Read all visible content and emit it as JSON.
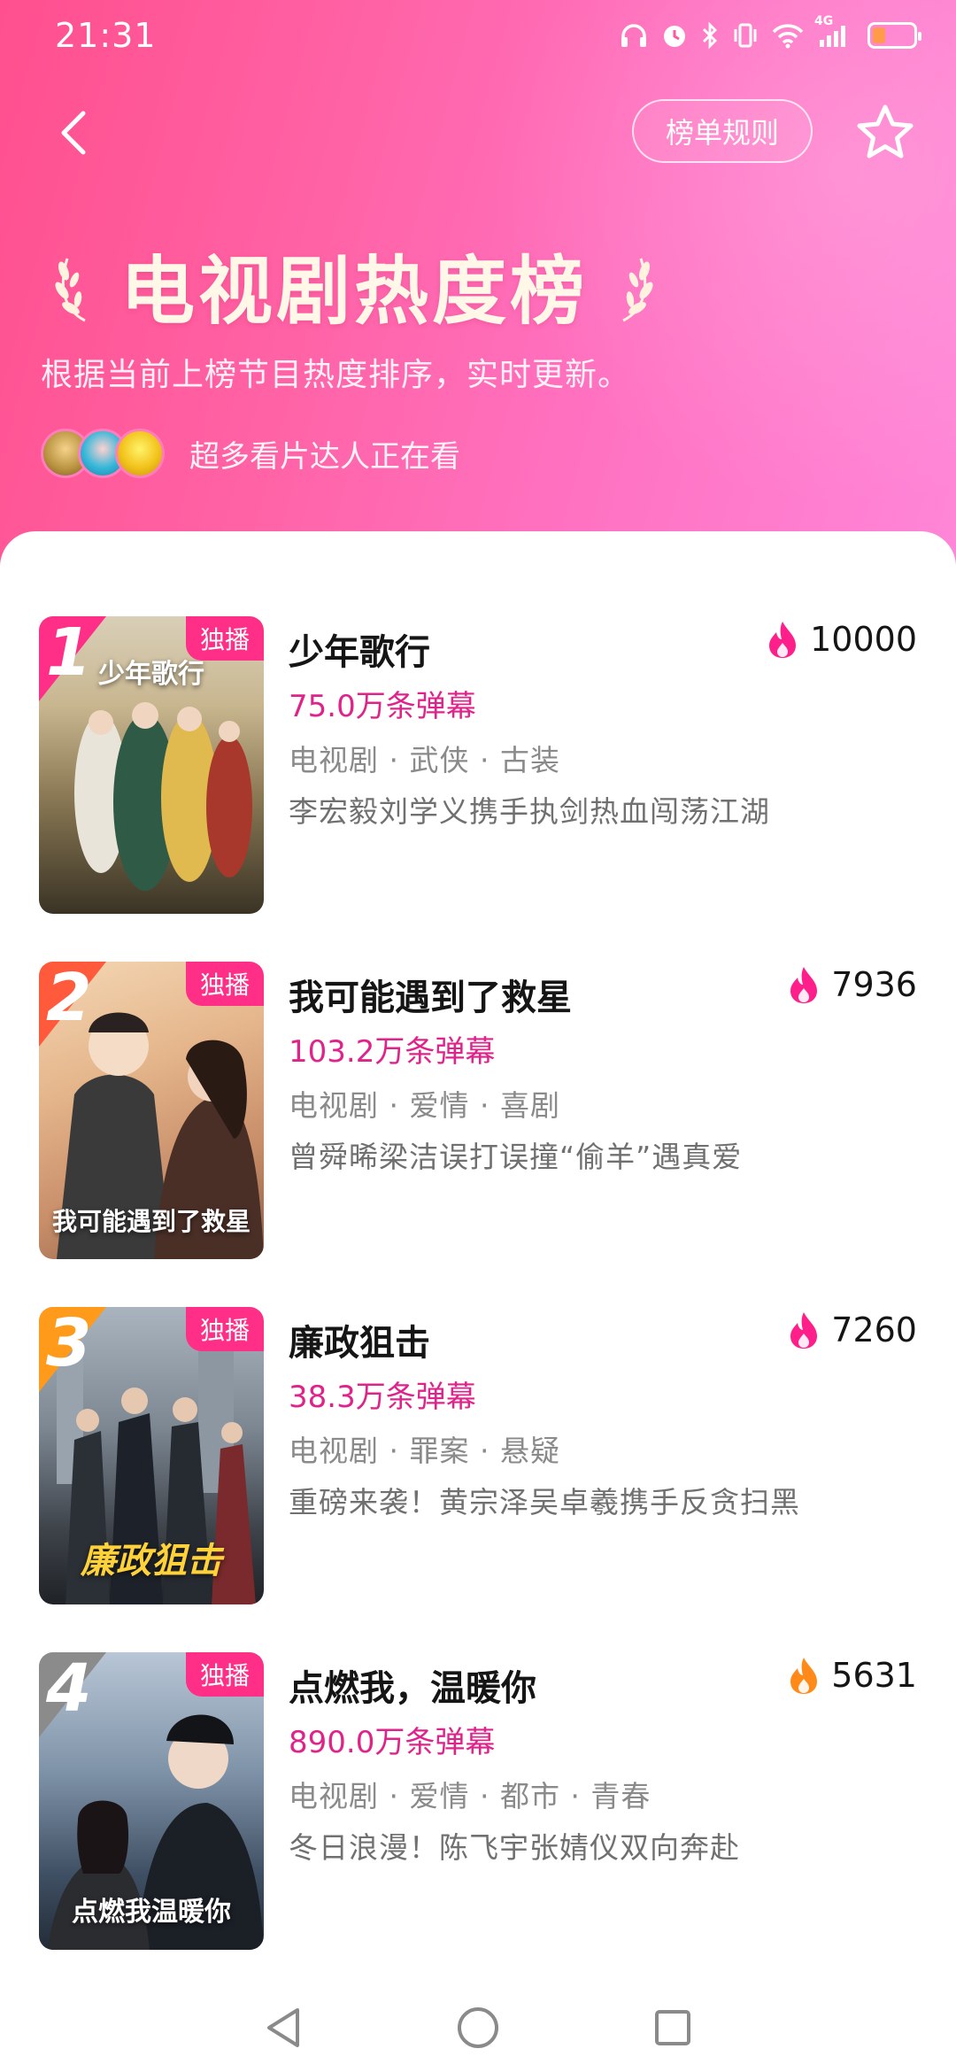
{
  "status_bar": {
    "time": "21:31",
    "network": "4G",
    "icons": [
      "headphones-icon",
      "alarm-icon",
      "bluetooth-icon",
      "vibrate-icon",
      "wifi-icon",
      "signal-icon",
      "battery-icon"
    ],
    "battery_level": 0.2
  },
  "header": {
    "rules_label": "榜单规则",
    "title": "电视剧热度榜",
    "subtitle": "根据当前上榜节目热度排序，实时更新。",
    "viewers_text": "超多看片达人正在看"
  },
  "colors": {
    "accent": "#e0238a",
    "badge": "#ff2e86",
    "rank1": "#ff2e86",
    "rank2": "#ff5a3c",
    "rank3": "#ff9a1a",
    "rank4": "#8b8b8b"
  },
  "items": [
    {
      "rank": "1",
      "badge": "独播",
      "title": "少年歌行",
      "heat": "10000",
      "danmu": "75.0万条弹幕",
      "tags": "电视剧 · 武侠 · 古装",
      "desc": "李宏毅刘学义携手执剑热血闯荡江湖",
      "poster_caption": "少年歌行"
    },
    {
      "rank": "2",
      "badge": "独播",
      "title": "我可能遇到了救星",
      "heat": "7936",
      "danmu": "103.2万条弹幕",
      "tags": "电视剧 · 爱情 · 喜剧",
      "desc": "曾舜晞梁洁误打误撞“偷羊”遇真爱",
      "poster_caption": "我可能遇到了救星"
    },
    {
      "rank": "3",
      "badge": "独播",
      "title": "廉政狙击",
      "heat": "7260",
      "danmu": "38.3万条弹幕",
      "tags": "电视剧 · 罪案 · 悬疑",
      "desc": "重磅来袭！黄宗泽吴卓羲携手反贪扫黑",
      "poster_caption": "廉政狙击"
    },
    {
      "rank": "4",
      "badge": "独播",
      "title": "点燃我，温暖你",
      "heat": "5631",
      "danmu": "890.0万条弹幕",
      "tags": "电视剧 · 爱情 · 都市 · 青春",
      "desc": "冬日浪漫！陈飞宇张婧仪双向奔赴",
      "poster_caption": "点燃我温暖你"
    }
  ]
}
